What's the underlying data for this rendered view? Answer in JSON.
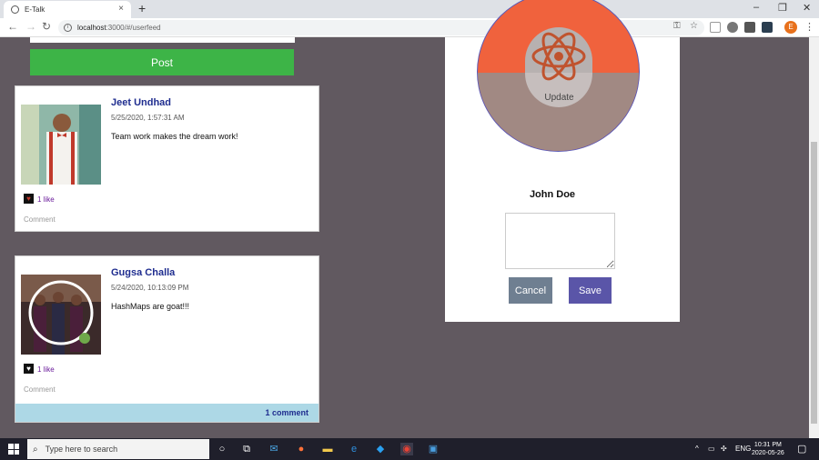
{
  "browser": {
    "tab_title": "E-Talk",
    "tab_close": "×",
    "new_tab": "+",
    "url_host": "localhost",
    "url_path": ":3000/#/userfeed",
    "minimize": "–",
    "restore": "❐",
    "close": "✕",
    "profile_initial": "E",
    "menu": "⋮"
  },
  "post_form": {
    "post_label": "Post"
  },
  "posts": [
    {
      "author": "Jeet Undhad",
      "date": "5/25/2020, 1:57:31 AM",
      "text": "Team work makes the dream work!",
      "like_count": "1 like",
      "comment_label": "Comment"
    },
    {
      "author": "Gugsa Challa",
      "date": "5/24/2020, 10:13:09 PM",
      "text": "HashMaps are goat!!!",
      "like_count": "1 like",
      "comment_label": "Comment",
      "comments_summary": "1 comment"
    }
  ],
  "profile": {
    "update_label": "Update",
    "name": "John Doe",
    "cancel_label": "Cancel",
    "save_label": "Save"
  },
  "taskbar": {
    "search_placeholder": "Type here to search",
    "language": "ENG",
    "time": "10:31 PM",
    "date": "2020-05-26"
  },
  "colors": {
    "page_bg": "#615960",
    "post_button": "#3db447",
    "cancel_button": "#6f7f91",
    "save_button": "#5a55a8",
    "comments_bar": "#add8e6",
    "react_orange": "#f0623d"
  }
}
